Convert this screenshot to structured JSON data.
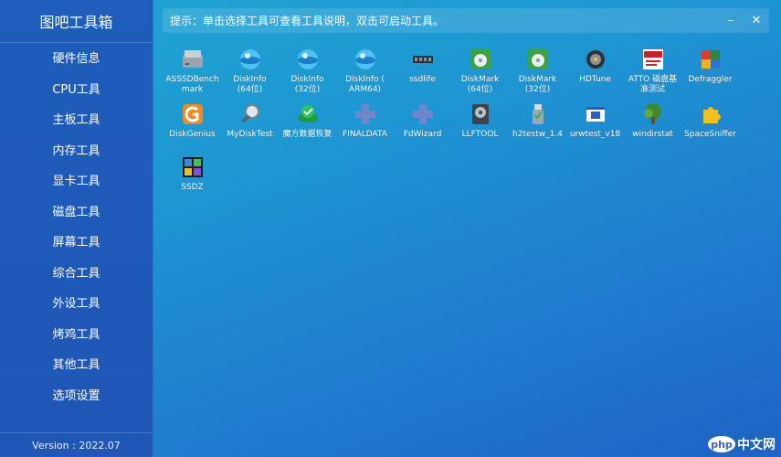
{
  "app": {
    "title": "图吧工具箱"
  },
  "sidebar": {
    "items": [
      {
        "label": "硬件信息"
      },
      {
        "label": "CPU工具"
      },
      {
        "label": "主板工具"
      },
      {
        "label": "内存工具"
      },
      {
        "label": "显卡工具"
      },
      {
        "label": "磁盘工具"
      },
      {
        "label": "屏幕工具"
      },
      {
        "label": "综合工具"
      },
      {
        "label": "外设工具"
      },
      {
        "label": "烤鸡工具"
      },
      {
        "label": "其他工具"
      },
      {
        "label": "选项设置"
      }
    ],
    "version": "Version : 2022.07"
  },
  "topbar": {
    "hint": "提示：单击选择工具可查看工具说明，双击可启动工具。",
    "minimize": "–",
    "close": "✕"
  },
  "tools": [
    {
      "label": "ASSSDBench\nmark",
      "icon": "ssd-drive-icon"
    },
    {
      "label": "DiskInfo\n(64位)",
      "icon": "diskinfo-globe-icon"
    },
    {
      "label": "DiskInfo\n(32位)",
      "icon": "diskinfo-globe-icon"
    },
    {
      "label": "DiskInfo (\nARM64)",
      "icon": "diskinfo-globe-icon"
    },
    {
      "label": "ssdlife",
      "icon": "memory-chip-icon"
    },
    {
      "label": "DiskMark\n(64位)",
      "icon": "diskmark-icon"
    },
    {
      "label": "DiskMark\n(32位)",
      "icon": "diskmark-icon"
    },
    {
      "label": "HDTune",
      "icon": "hard-disk-icon"
    },
    {
      "label": "ATTO  磁盘基\n准测试",
      "icon": "atto-icon"
    },
    {
      "label": "Defraggler",
      "icon": "defraggler-cube-icon"
    },
    {
      "label": "DiskGenius",
      "icon": "diskgenius-icon"
    },
    {
      "label": "MyDiskTest",
      "icon": "magnifier-icon"
    },
    {
      "label": "魔方数据恢复",
      "icon": "data-recovery-icon"
    },
    {
      "label": "FINALDATA",
      "icon": "puzzle-cross-icon"
    },
    {
      "label": "FdWizard",
      "icon": "puzzle-cross-icon"
    },
    {
      "label": "LLFTOOL",
      "icon": "disk-tool-icon"
    },
    {
      "label": "h2testw_1.4",
      "icon": "usb-stick-icon"
    },
    {
      "label": "urwtest_v18",
      "icon": "window-test-icon"
    },
    {
      "label": "windirstat",
      "icon": "tree-icon"
    },
    {
      "label": "SpaceSniffer",
      "icon": "puzzle-piece-icon"
    },
    {
      "label": "SSDZ",
      "icon": "ssdz-grid-icon"
    }
  ],
  "watermark": {
    "logo": "php",
    "text": "中文网"
  }
}
